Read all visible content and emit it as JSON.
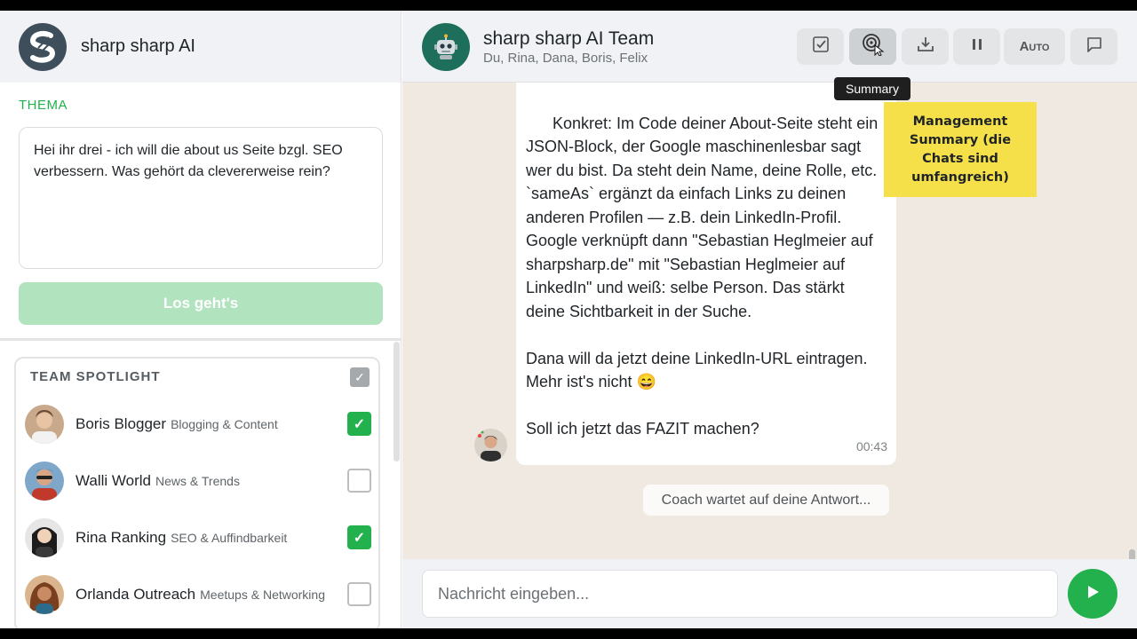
{
  "sidebar": {
    "app_name": "sharp sharp AI",
    "thema_label": "THEMA",
    "thema_text": "Hei ihr drei - ich will die about us Seite bzgl. SEO verbessern. Was gehört da clevererweise rein?",
    "start_button": "Los geht's",
    "spotlight_title": "TEAM SPOTLIGHT",
    "spotlight_all_checked": true,
    "members": [
      {
        "name": "Boris Blogger",
        "role": "Blogging & Content",
        "checked": true
      },
      {
        "name": "Walli World",
        "role": "News & Trends",
        "checked": false
      },
      {
        "name": "Rina Ranking",
        "role": "SEO & Auffindbarkeit",
        "checked": true
      },
      {
        "name": "Orlanda Outreach",
        "role": "Meetups & Networking",
        "checked": false
      }
    ]
  },
  "header": {
    "team_name": "sharp sharp AI Team",
    "team_members": "Du, Rina, Dana, Boris, Felix",
    "auto_label": "Auto",
    "tooltip": "Summary",
    "icons": [
      "checkbox-icon",
      "summary-target-icon",
      "download-icon",
      "pause-icon",
      "chat-bubble-icon"
    ]
  },
  "chat": {
    "message_text": "Konkret: Im Code deiner About-Seite steht ein JSON-Block, der Google maschinenlesbar sagt wer du bist. Da steht dein Name, deine Rolle, etc. `sameAs` ergänzt da einfach Links zu deinen anderen Profilen — z.B. dein LinkedIn-Profil. Google verknüpft dann \"Sebastian Heglmeier auf sharpsharp.de\" mit \"Sebastian Heglmeier auf LinkedIn\" und weiß: selbe Person. Das stärkt deine Sichtbarkeit in der Suche.\n\nDana will da jetzt deine LinkedIn-URL eintragen. Mehr ist's nicht 😄\n\nSoll ich jetzt das FAZIT machen?",
    "message_time": "00:43",
    "coach_status": "Coach wartet auf deine Antwort...",
    "sticky_note": "Management Summary (die Chats sind umfangreich)",
    "input_placeholder": "Nachricht eingeben..."
  },
  "colors": {
    "accent": "#22b14c",
    "start_button_disabled": "#b2e3bf",
    "chat_background": "#efe9e1",
    "sticky_note": "#f6e04a",
    "team_avatar": "#1d6e5a",
    "logo": "#3e4f5b"
  }
}
